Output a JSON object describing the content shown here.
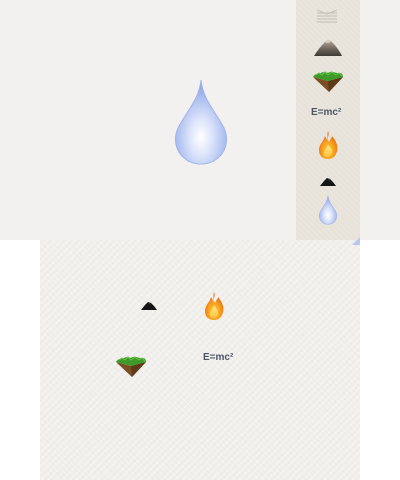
{
  "top_screen": {
    "selected_element": {
      "name": "water",
      "icon": "water-drop-icon"
    }
  },
  "workspace": {
    "elements": [
      {
        "id": "ws-coal",
        "icon": "coal-icon"
      },
      {
        "id": "ws-fire",
        "icon": "fire-icon"
      },
      {
        "id": "ws-earth",
        "icon": "earth-icon"
      },
      {
        "id": "ws-energy",
        "icon": "energy-formula-icon",
        "label": "E=mc²"
      }
    ]
  },
  "inventory": {
    "items": [
      {
        "id": "inv-stone",
        "icon": "stone-pile-icon"
      },
      {
        "id": "inv-earth",
        "icon": "earth-icon"
      },
      {
        "id": "inv-energy",
        "icon": "energy-formula-icon",
        "label": "E=mc²"
      },
      {
        "id": "inv-fire",
        "icon": "fire-icon"
      },
      {
        "id": "inv-coal",
        "icon": "coal-icon"
      },
      {
        "id": "inv-water",
        "icon": "water-drop-icon"
      }
    ]
  },
  "colors": {
    "top_background": "#f2f1ef",
    "workspace_background": "#f1efeb",
    "inventory_background": "#e9e5dd",
    "formula_text": "#4d5466",
    "water": "#9db6ec",
    "fire": "#f28a1a",
    "grass": "#3f9a2a",
    "dirt": "#7a4e22",
    "coal": "#151515",
    "stone": "#6f675c"
  }
}
